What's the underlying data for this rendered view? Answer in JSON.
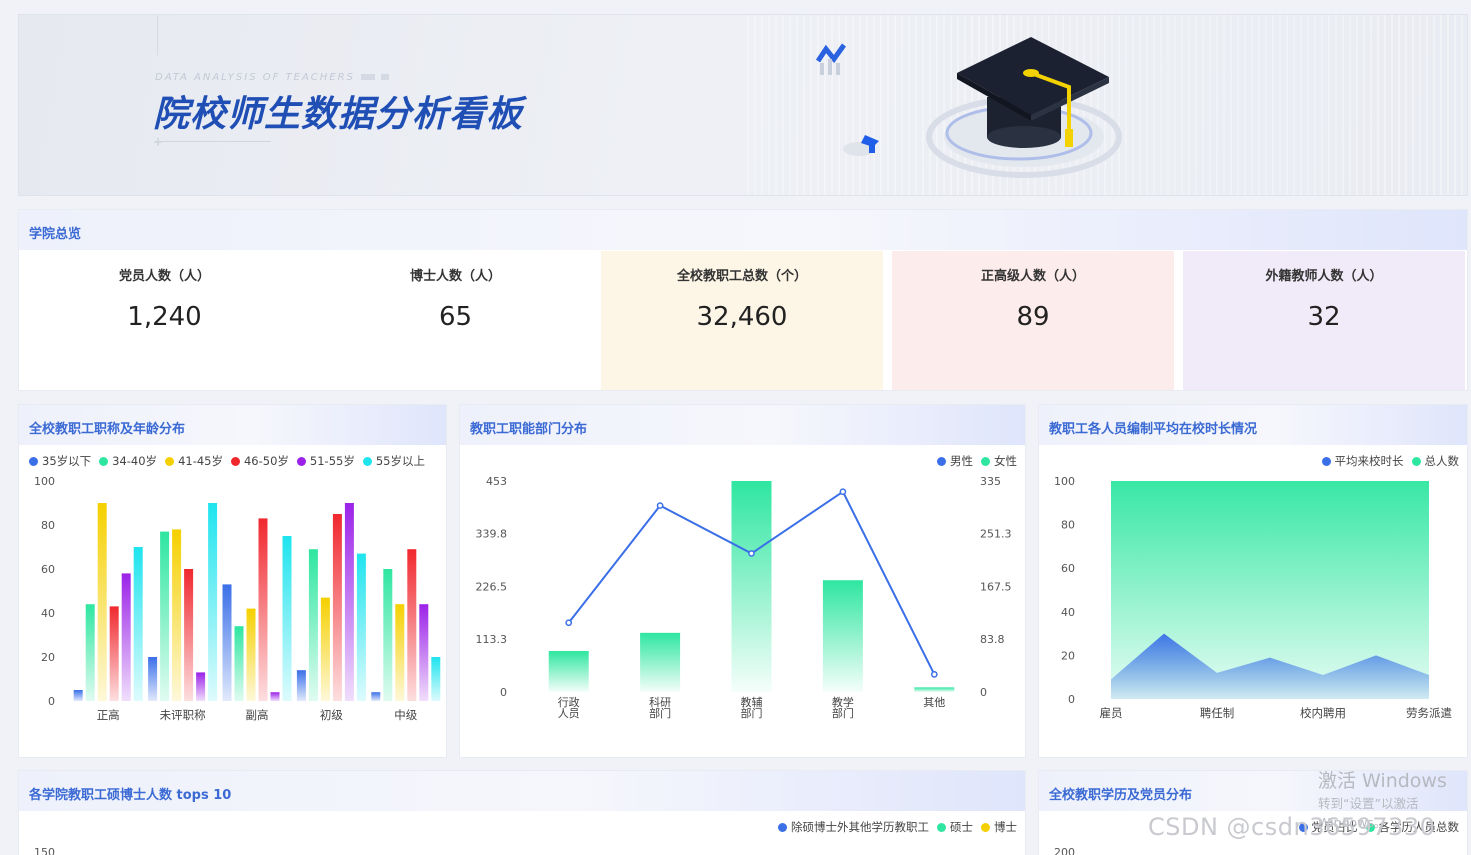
{
  "banner": {
    "subtitle": "DATA ANALYSIS OF TEACHERS",
    "title": "院校师生数据分析看板"
  },
  "overview": {
    "title": "学院总览",
    "stats": [
      {
        "label": "党员人数（人）",
        "value": "1,240",
        "bg": "#ffffff"
      },
      {
        "label": "博士人数（人）",
        "value": "65",
        "bg": "#ffffff"
      },
      {
        "label": "全校教职工总数（个）",
        "value": "32,460",
        "bg": "#fdf6e7"
      },
      {
        "label": "正高级人数（人）",
        "value": "89",
        "bg": "#fdecec"
      },
      {
        "label": "外籍教师人数（人）",
        "value": "32",
        "bg": "#f1eaf8"
      }
    ]
  },
  "panel_titles": {
    "title_age": "全校教职工职称及年龄分布",
    "dept": "教职工职能部门分布",
    "tenure": "教职工各人员编制平均在校时长情况",
    "tops": "各学院教职工硕博士人数 tops 10",
    "edu": "全校教职学历及党员分布"
  },
  "chart_data": [
    {
      "type": "bar",
      "title": "全校教职工职称及年龄分布",
      "categories": [
        "正高",
        "未评职称",
        "副高",
        "初级",
        "中级"
      ],
      "series": [
        {
          "name": "35岁以下",
          "color": "#3a6fe8",
          "values": [
            5,
            20,
            53,
            14,
            4
          ]
        },
        {
          "name": "34-40岁",
          "color": "#2ee6a0",
          "values": [
            44,
            77,
            34,
            69,
            60
          ]
        },
        {
          "name": "41-45岁",
          "color": "#f5d000",
          "values": [
            90,
            78,
            42,
            47,
            44
          ]
        },
        {
          "name": "46-50岁",
          "color": "#f0282e",
          "values": [
            43,
            60,
            83,
            85,
            69
          ]
        },
        {
          "name": "51-55岁",
          "color": "#9b22e8",
          "values": [
            58,
            13,
            4,
            90,
            44
          ]
        },
        {
          "name": "55岁以上",
          "color": "#1ee4ee",
          "values": [
            70,
            90,
            75,
            67,
            20
          ]
        }
      ],
      "yticks": [
        "0",
        "20",
        "40",
        "60",
        "80",
        "100"
      ],
      "ylim": [
        0,
        100
      ]
    },
    {
      "type": "bar",
      "title": "教职工职能部门分布",
      "categories": [
        "行政\n人员",
        "科研\n部门",
        "教辅\n部门",
        "教学\n部门",
        "其他"
      ],
      "series": [
        {
          "name": "男性",
          "color": "#3a6fe8",
          "type": "line",
          "axis": "right",
          "values": [
            110,
            296,
            220,
            318,
            28
          ]
        },
        {
          "name": "女性",
          "color": "#2ee6a0",
          "type": "bar",
          "axis": "left",
          "values": [
            88,
            127,
            453,
            240,
            10
          ]
        }
      ],
      "yticks_left": [
        "0",
        "113.3",
        "226.5",
        "339.8",
        "453"
      ],
      "yticks_right": [
        "0",
        "83.8",
        "167.5",
        "251.3",
        "335"
      ],
      "ylim_left": [
        0,
        453
      ],
      "ylim_right": [
        0,
        335
      ]
    },
    {
      "type": "area",
      "title": "教职工各人员编制平均在校时长情况",
      "categories": [
        "雇员",
        "聘任制",
        "校内聘用",
        "劳务派遣"
      ],
      "series": [
        {
          "name": "平均来校时长",
          "color": "#3a6fe8",
          "values": [
            9,
            30,
            12,
            19,
            11,
            20,
            11
          ]
        },
        {
          "name": "总人数",
          "color": "#2ee6a0",
          "values": [
            100,
            100,
            100,
            100,
            100,
            100,
            100
          ]
        }
      ],
      "yticks": [
        "0",
        "20",
        "40",
        "60",
        "80",
        "100"
      ],
      "ylim": [
        0,
        100
      ]
    },
    {
      "type": "bar",
      "title": "各学院教职工硕博士人数 tops 10",
      "series": [
        {
          "name": "除硕博士外其他学历教职工",
          "color": "#3a6fe8"
        },
        {
          "name": "硕士",
          "color": "#2ee6a0"
        },
        {
          "name": "博士",
          "color": "#f5d000"
        }
      ],
      "yticks": [
        "150"
      ]
    },
    {
      "type": "line",
      "title": "全校教职学历及党员分布",
      "series": [
        {
          "name": "党员占比",
          "color": "#3a6fe8"
        },
        {
          "name": "各学历人员总数",
          "color": "#2ee6a0"
        }
      ],
      "yticks": [
        "200"
      ]
    }
  ],
  "watermark": {
    "line1": "激活 Windows",
    "line2": "转到“设置”以激活 Windows。",
    "csdn": "CSDN @csdn36597330"
  }
}
